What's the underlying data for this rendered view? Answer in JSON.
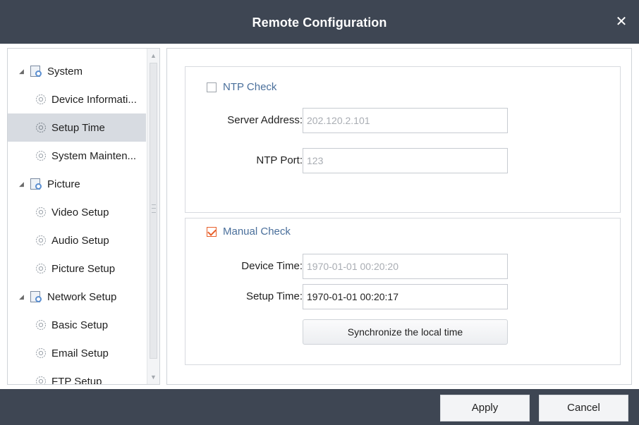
{
  "window": {
    "title": "Remote Configuration",
    "close_label": "✕"
  },
  "tree": {
    "items": [
      {
        "label": "System",
        "type": "group"
      },
      {
        "label": "Device Informati...",
        "type": "child"
      },
      {
        "label": "Setup Time",
        "type": "child",
        "selected": true
      },
      {
        "label": "System Mainten...",
        "type": "child"
      },
      {
        "label": "Picture",
        "type": "group"
      },
      {
        "label": "Video Setup",
        "type": "child"
      },
      {
        "label": "Audio Setup",
        "type": "child"
      },
      {
        "label": "Picture Setup",
        "type": "child"
      },
      {
        "label": "Network Setup",
        "type": "group"
      },
      {
        "label": "Basic Setup",
        "type": "child"
      },
      {
        "label": "Email Setup",
        "type": "child"
      },
      {
        "label": "FTP Setup",
        "type": "child"
      }
    ]
  },
  "ntp": {
    "check_label": "NTP Check",
    "checked": false,
    "server_address_label": "Server Address:",
    "server_address_value": "202.120.2.101",
    "port_label": "NTP Port:",
    "port_value": "123"
  },
  "manual": {
    "check_label": "Manual Check",
    "checked": true,
    "device_time_label": "Device Time:",
    "device_time_value": "1970-01-01 00:20:20",
    "setup_time_label": "Setup Time:",
    "setup_time_value": "1970-01-01 00:20:17",
    "sync_button_label": "Synchronize the local time"
  },
  "footer": {
    "apply_label": "Apply",
    "cancel_label": "Cancel"
  },
  "colors": {
    "titlebar": "#3e4653",
    "accent_check": "#e8612c",
    "check_label": "#4a6f9b",
    "selected_row": "#d7dbe1"
  }
}
